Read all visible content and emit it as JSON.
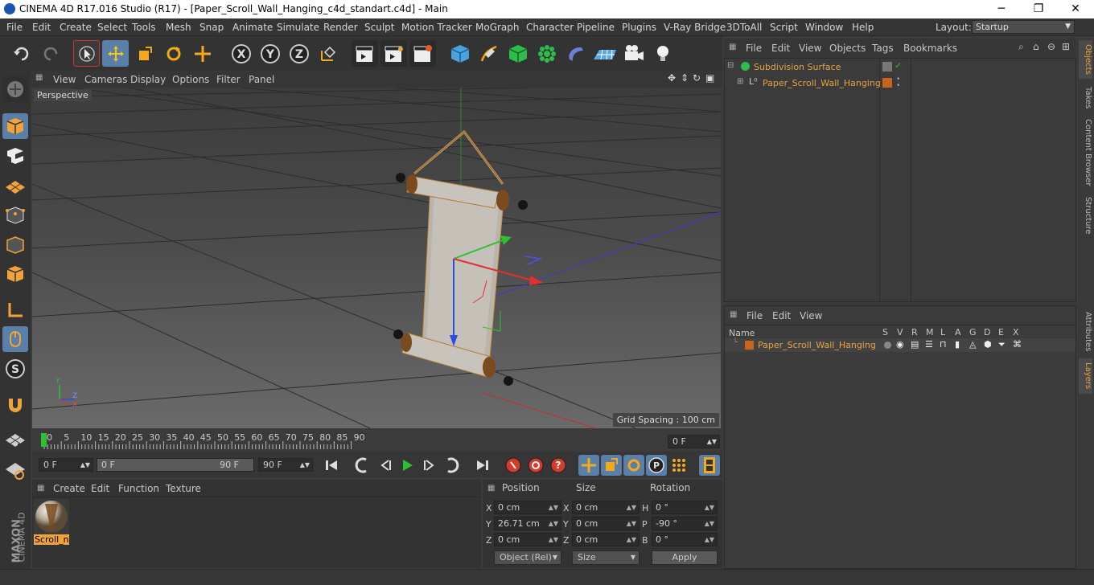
{
  "window": {
    "title": "CINEMA 4D R17.016 Studio (R17) - [Paper_Scroll_Wall_Hanging_c4d_standart.c4d] - Main",
    "minimize": "─",
    "maximize": "❐",
    "close": "✕"
  },
  "menu": [
    "File",
    "Edit",
    "Create",
    "Select",
    "Tools",
    "Mesh",
    "Snap",
    "Animate",
    "Simulate",
    "Render",
    "Sculpt",
    "Motion Tracker",
    "MoGraph",
    "Character",
    "Pipeline",
    "Plugins",
    "V-Ray Bridge",
    "3DToAll",
    "Script",
    "Window",
    "Help"
  ],
  "layout": {
    "label": "Layout:",
    "value": "Startup"
  },
  "viewport": {
    "menu": [
      "View",
      "Cameras",
      "Display",
      "Options",
      "Filter",
      "Panel"
    ],
    "camera_label": "Perspective",
    "grid_spacing": "Grid Spacing : 100 cm",
    "axis_x": "X",
    "axis_y": "Y",
    "axis_z": "Z"
  },
  "timeline": {
    "ticks": [
      "0",
      "5",
      "10",
      "15",
      "20",
      "25",
      "30",
      "35",
      "40",
      "45",
      "50",
      "55",
      "60",
      "65",
      "70",
      "75",
      "80",
      "85",
      "90"
    ],
    "current_frame": "0 F"
  },
  "transport": {
    "start": "0 F",
    "range_start": "0 F",
    "range_end": "90 F",
    "end": "90 F"
  },
  "material_panel": {
    "menu": [
      "Create",
      "Edit",
      "Function",
      "Texture"
    ],
    "material_name": "Scroll_n"
  },
  "coords": {
    "headers": [
      "Position",
      "Size",
      "Rotation"
    ],
    "rows": [
      {
        "axis": "X",
        "pos": "0 cm",
        "size_axis": "X",
        "size": "0 cm",
        "rot_axis": "H",
        "rot": "0 °"
      },
      {
        "axis": "Y",
        "pos": "26.71 cm",
        "size_axis": "Y",
        "size": "0 cm",
        "rot_axis": "P",
        "rot": "-90 °"
      },
      {
        "axis": "Z",
        "pos": "0 cm",
        "size_axis": "Z",
        "size": "0 cm",
        "rot_axis": "B",
        "rot": "0 °"
      }
    ],
    "mode": "Object (Rel)",
    "size_mode": "Size",
    "apply": "Apply"
  },
  "objects_panel": {
    "menu": [
      "File",
      "Edit",
      "View",
      "Objects",
      "Tags",
      "Bookmarks"
    ],
    "items": [
      {
        "name": "Subdivision Surface"
      },
      {
        "name": "Paper_Scroll_Wall_Hanging"
      }
    ]
  },
  "layers_panel": {
    "menu": [
      "File",
      "Edit",
      "View"
    ],
    "col_name": "Name",
    "cols": [
      "S",
      "V",
      "R",
      "M",
      "L",
      "A",
      "G",
      "D",
      "E",
      "X"
    ],
    "items": [
      {
        "name": "Paper_Scroll_Wall_Hanging"
      }
    ]
  },
  "side_tabs": [
    "Objects",
    "Takes",
    "Content Browser",
    "Structure",
    "Attributes",
    "Layers"
  ],
  "brand": {
    "maxon": "MAXON",
    "product": "CINEMA 4D"
  },
  "colors": {
    "accent": "#5a7fa8",
    "orange": "#e8a33d",
    "layer": "#c8641e"
  }
}
